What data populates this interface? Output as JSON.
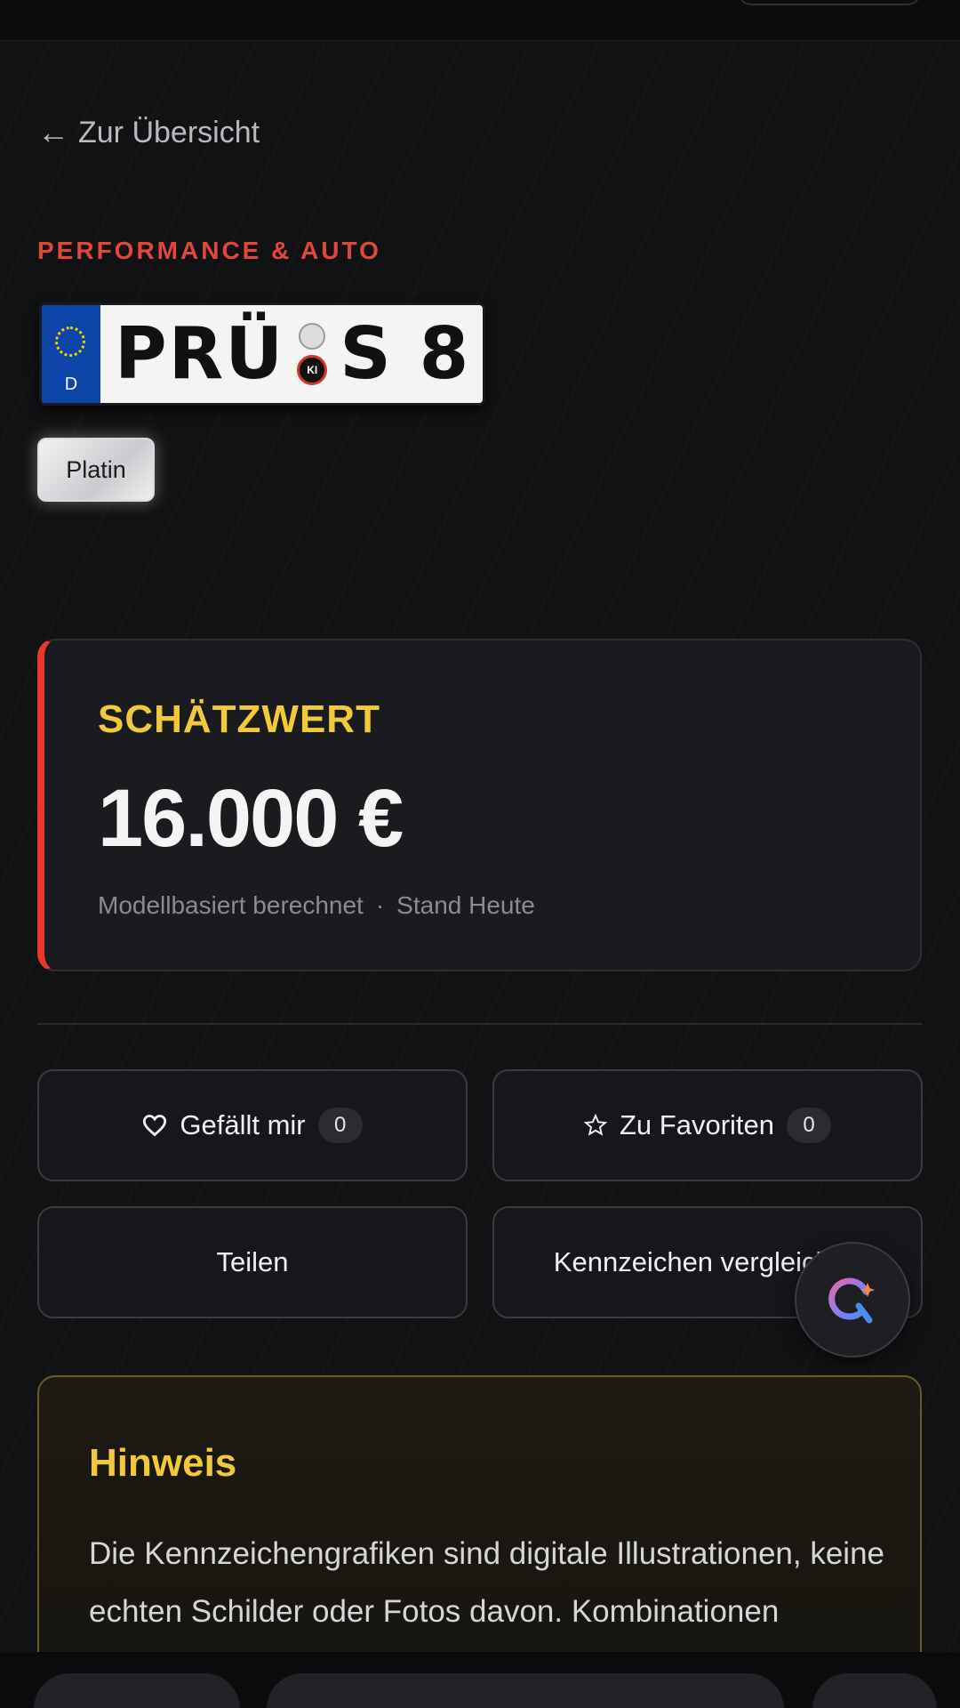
{
  "nav": {
    "back_arrow": "←",
    "back_label": "Zur Übersicht"
  },
  "listing": {
    "category": "PERFORMANCE & AUTO",
    "plate": {
      "country": "D",
      "part1": "PRÜ",
      "part2": "S 8",
      "seal_text": "KI"
    },
    "tier": "Platin"
  },
  "estimate": {
    "label": "SCHÄTZWERT",
    "value": "16.000 €",
    "method": "Modellbasiert berechnet",
    "separator": "·",
    "as_of": "Stand Heute"
  },
  "actions": {
    "like_label": "Gefällt mir",
    "like_count": "0",
    "favorite_label": "Zu Favoriten",
    "favorite_count": "0",
    "share_label": "Teilen",
    "compare_label": "Kennzeichen vergleichen"
  },
  "notice": {
    "title": "Hinweis",
    "text": "Die Kennzeichengrafiken sind digitale Illustrationen, keine echten Schilder oder Fotos davon. Kombinationen können real existieren; die Grafik"
  },
  "colors": {
    "accent_red": "#e8392f",
    "accent_gold": "#f3c93c",
    "background": "#111214"
  }
}
